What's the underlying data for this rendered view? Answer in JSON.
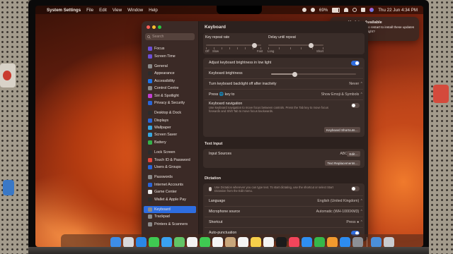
{
  "menubar": {
    "app_name": "System Settings",
    "menus": [
      "File",
      "Edit",
      "View",
      "Window",
      "Help"
    ],
    "battery": "69%",
    "datetime": "Thu 22 Jun  4:34 PM"
  },
  "notification": {
    "title": "Updates Available",
    "body": "Do you want to restart to install these updates now or try tonight?"
  },
  "window": {
    "title": "Keyboard",
    "search_placeholder": "Search",
    "sidebar": {
      "items": [
        {
          "label": "Focus",
          "color": "#6c4fd6"
        },
        {
          "label": "Screen Time",
          "color": "#6c4fd6"
        },
        {
          "label": "General",
          "color": "#8a8a8a"
        },
        {
          "label": "Appearance",
          "color": "#2c2c2c"
        },
        {
          "label": "Accessibility",
          "color": "#1e73e8"
        },
        {
          "label": "Control Centre",
          "color": "#8a8a8a"
        },
        {
          "label": "Siri & Spotlight",
          "color": "#c13fd1"
        },
        {
          "label": "Privacy & Security",
          "color": "#2a66d8"
        },
        {
          "label": "Desktop & Dock",
          "color": "#2c2c2c"
        },
        {
          "label": "Displays",
          "color": "#2a66d8"
        },
        {
          "label": "Wallpaper",
          "color": "#37a6e0"
        },
        {
          "label": "Screen Saver",
          "color": "#37a6e0"
        },
        {
          "label": "Battery",
          "color": "#34b24a"
        },
        {
          "label": "Lock Screen",
          "color": "#2c2c2c"
        },
        {
          "label": "Touch ID & Password",
          "color": "#e2483f"
        },
        {
          "label": "Users & Groups",
          "color": "#2a66d8"
        },
        {
          "label": "Passwords",
          "color": "#8a8a8a"
        },
        {
          "label": "Internet Accounts",
          "color": "#2a66d8"
        },
        {
          "label": "Game Center",
          "color": "#e8e8e8"
        },
        {
          "label": "Wallet & Apple Pay",
          "color": "#2c2c2c"
        },
        {
          "label": "Keyboard",
          "color": "#8a8a8a"
        },
        {
          "label": "Trackpad",
          "color": "#8a8a8a"
        },
        {
          "label": "Printers & Scanners",
          "color": "#8a8a8a"
        }
      ],
      "selected": "Keyboard"
    },
    "keyboard": {
      "key_repeat_rate_label": "Key repeat rate",
      "delay_until_repeat_label": "Delay until repeat",
      "repeat_off": "Off",
      "repeat_slow": "Slow",
      "repeat_fast": "Fast",
      "delay_long": "Long",
      "delay_short": "Short",
      "key_repeat_rate_level": 0.88,
      "delay_until_repeat_level": 0.78,
      "adjust_brightness_label": "Adjust keyboard brightness in low light",
      "adjust_brightness_on": true,
      "brightness_label": "Keyboard brightness",
      "brightness_level": 0.28,
      "backlight_off_label": "Turn keyboard backlight off after inactivity",
      "backlight_off_value": "Never",
      "press_key_label": "Press 🌐 key to",
      "press_key_value": "Show Emoji & Symbols",
      "nav_label": "Keyboard navigation",
      "nav_desc": "Use keyboard navigation to move focus between controls. Press the Tab key to move focus forwards and Shift Tab to move focus backwards.",
      "nav_on": false,
      "shortcuts_button": "Keyboard Shortcuts…"
    },
    "text_input": {
      "heading": "Text Input",
      "input_sources_label": "Input Sources",
      "input_sources_value": "ABC",
      "edit_button": "Edit…",
      "replacements_button": "Text Replacements…"
    },
    "dictation": {
      "heading": "Dictation",
      "desc": "Use Dictation wherever you can type text. To start dictating, use the shortcut or select Start Dictation from the Edit menu.",
      "on": false,
      "language_label": "Language",
      "language_value": "English (United Kingdom)",
      "mic_label": "Microphone source",
      "mic_value": "Automatic (WH-1000XM3)",
      "shortcut_label": "Shortcut",
      "shortcut_value": "Press",
      "auto_punct_label": "Auto-punctuation",
      "auto_punct_on": true
    }
  },
  "dock": {
    "apps": [
      {
        "name": "finder-icon",
        "color": "#3d8de8"
      },
      {
        "name": "launchpad-icon",
        "color": "#d9d9dc"
      },
      {
        "name": "safari-icon",
        "color": "#2a87e6"
      },
      {
        "name": "messages-icon",
        "color": "#3fca52"
      },
      {
        "name": "mail-icon",
        "color": "#3aa1f0"
      },
      {
        "name": "maps-icon",
        "color": "#62c466"
      },
      {
        "name": "photos-icon",
        "color": "#f2f2f2"
      },
      {
        "name": "facetime-icon",
        "color": "#3fca52"
      },
      {
        "name": "calendar-icon",
        "color": "#f4f4f4"
      },
      {
        "name": "contacts-icon",
        "color": "#c9a77c"
      },
      {
        "name": "reminders-icon",
        "color": "#f4f4f4"
      },
      {
        "name": "notes-icon",
        "color": "#f7d04a"
      },
      {
        "name": "freeform-icon",
        "color": "#f4f4f4"
      },
      {
        "name": "tv-icon",
        "color": "#1b1b1b"
      },
      {
        "name": "music-icon",
        "color": "#f2455b"
      },
      {
        "name": "keynote-icon",
        "color": "#2f8ff0"
      },
      {
        "name": "numbers-icon",
        "color": "#36b84a"
      },
      {
        "name": "pages-icon",
        "color": "#f29a2e"
      },
      {
        "name": "app-store-icon",
        "color": "#2d8cf0"
      },
      {
        "name": "system-settings-icon",
        "color": "#8d9096"
      },
      {
        "name": "downloads-folder-icon",
        "color": "#4b8fd9"
      },
      {
        "name": "trash-icon",
        "color": "#c9cbd0"
      }
    ]
  }
}
